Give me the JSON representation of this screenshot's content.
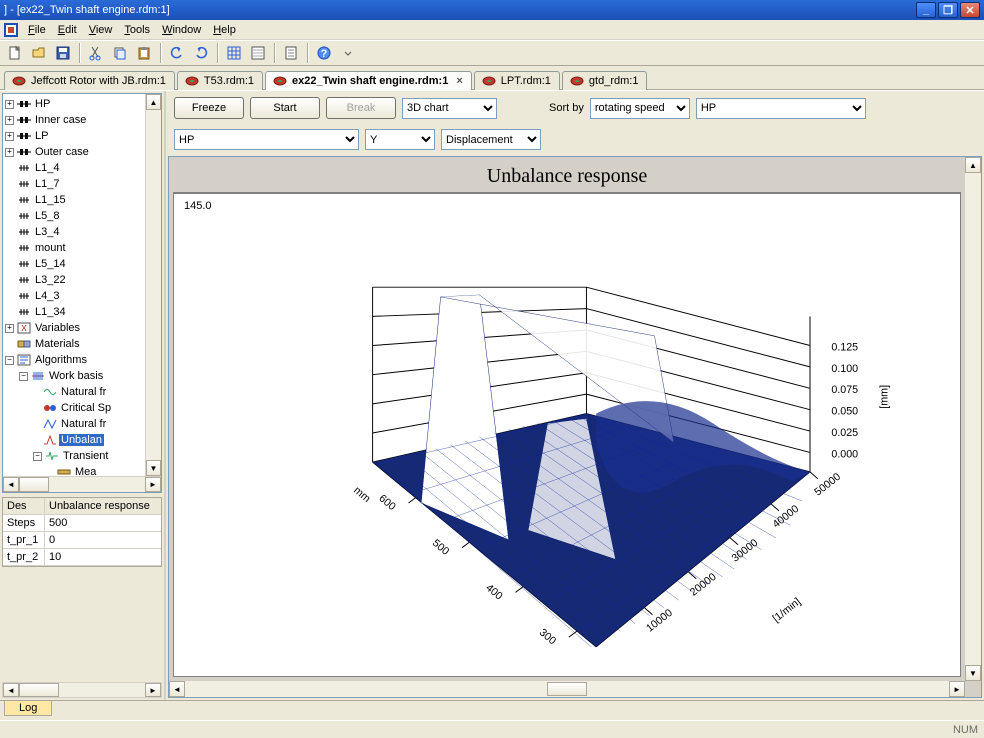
{
  "window": {
    "title": "] - [ex22_Twin shaft engine.rdm:1]"
  },
  "menu": {
    "file": "File",
    "edit": "Edit",
    "view": "View",
    "tools": "Tools",
    "window": "Window",
    "help": "Help"
  },
  "tabs": [
    {
      "label": "Jeffcott Rotor with JB.rdm:1",
      "active": false
    },
    {
      "label": "T53.rdm:1",
      "active": false
    },
    {
      "label": "ex22_Twin shaft engine.rdm:1",
      "active": true
    },
    {
      "label": "LPT.rdm:1",
      "active": false
    },
    {
      "label": "gtd_rdm:1",
      "active": false
    }
  ],
  "tree": {
    "items": [
      "HP",
      "Inner case",
      "LP",
      "Outer case",
      "L1_4",
      "L1_7",
      "L1_15",
      "L5_8",
      "L3_4",
      "mount",
      "L5_14",
      "L3_22",
      "L4_3",
      "L1_34",
      "Variables",
      "Materials",
      "Algorithms",
      "Work basis",
      "Natural fr",
      "Critical Sp",
      "Natural fr",
      "Unbalan",
      "Transient",
      "Mea"
    ]
  },
  "props": {
    "header": {
      "c1": "Des",
      "c2": "Unbalance response"
    },
    "rows": [
      {
        "c1": "Steps",
        "c2": "500"
      },
      {
        "c1": "t_pr_1",
        "c2": "0"
      },
      {
        "c1": "t_pr_2",
        "c2": "10"
      }
    ]
  },
  "controls": {
    "freeze": "Freeze",
    "start": "Start",
    "break": "Break",
    "chartType": "3D chart",
    "sortByLabel": "Sort by",
    "sortBy": "rotating speed",
    "series": "HP",
    "xsel": "HP",
    "ysel": "Y",
    "zsel": "Displacement"
  },
  "chart": {
    "title": "Unbalance response",
    "y_readout": "145.0",
    "z_ticks": [
      "0.125",
      "0.100",
      "0.075",
      "0.050",
      "0.025",
      "0.000"
    ],
    "z_unit": "[mm]",
    "x_ticks": [
      "10000",
      "20000",
      "30000",
      "40000",
      "50000"
    ],
    "x_unit": "[1/min]",
    "y_ticks": [
      "300",
      "400",
      "500",
      "600"
    ],
    "y_unit": "mm"
  },
  "chart_data": {
    "type": "surface3d",
    "title": "Unbalance response",
    "x_axis": {
      "label": "[1/min]",
      "range": [
        0,
        50000
      ],
      "ticks": [
        10000,
        20000,
        30000,
        40000,
        50000
      ]
    },
    "y_axis": {
      "label": "mm",
      "range": [
        250,
        650
      ],
      "ticks": [
        300,
        400,
        500,
        600
      ]
    },
    "z_axis": {
      "label": "[mm]",
      "range": [
        0,
        0.145
      ],
      "ticks": [
        0,
        0.025,
        0.05,
        0.075,
        0.1,
        0.125
      ]
    },
    "note": "Displacement amplitude surface with resonant ridge near ~12000 1/min reaching ~0.145 mm; broad low plateau (<0.03 mm) over most of the speed range with secondary undulations 20000–45000 1/min."
  },
  "log": {
    "tab": "Log"
  },
  "status": {
    "left": "",
    "num": "NUM"
  }
}
